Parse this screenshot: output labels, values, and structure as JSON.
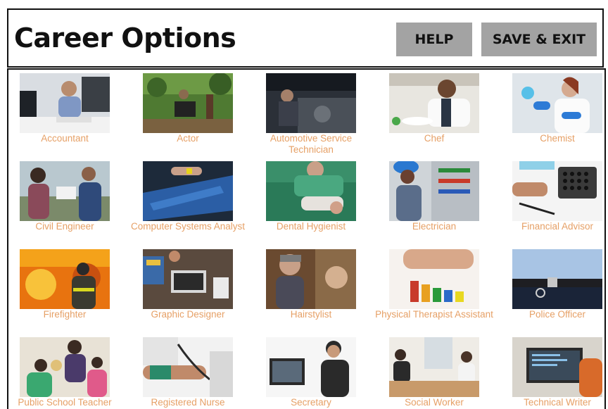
{
  "header": {
    "title": "Career Options",
    "help_label": "HELP",
    "save_exit_label": "SAVE & EXIT"
  },
  "careers": [
    {
      "label": "Accountant"
    },
    {
      "label": "Actor"
    },
    {
      "label": "Automotive Service Technician"
    },
    {
      "label": "Chef"
    },
    {
      "label": "Chemist"
    },
    {
      "label": "Civil Engineer"
    },
    {
      "label": "Computer Systems Analyst"
    },
    {
      "label": "Dental Hygienist"
    },
    {
      "label": "Electrician"
    },
    {
      "label": "Financial Advisor"
    },
    {
      "label": "Firefighter"
    },
    {
      "label": "Graphic Designer"
    },
    {
      "label": "Hairstylist"
    },
    {
      "label": "Physical Therapist Assistant"
    },
    {
      "label": "Police Officer"
    },
    {
      "label": "Public School Teacher"
    },
    {
      "label": "Registered Nurse"
    },
    {
      "label": "Secretary"
    },
    {
      "label": "Social Worker"
    },
    {
      "label": "Technical Writer"
    }
  ],
  "colors": {
    "caption": "#e6a066",
    "button_bg": "#a3a3a3",
    "border": "#111111"
  }
}
